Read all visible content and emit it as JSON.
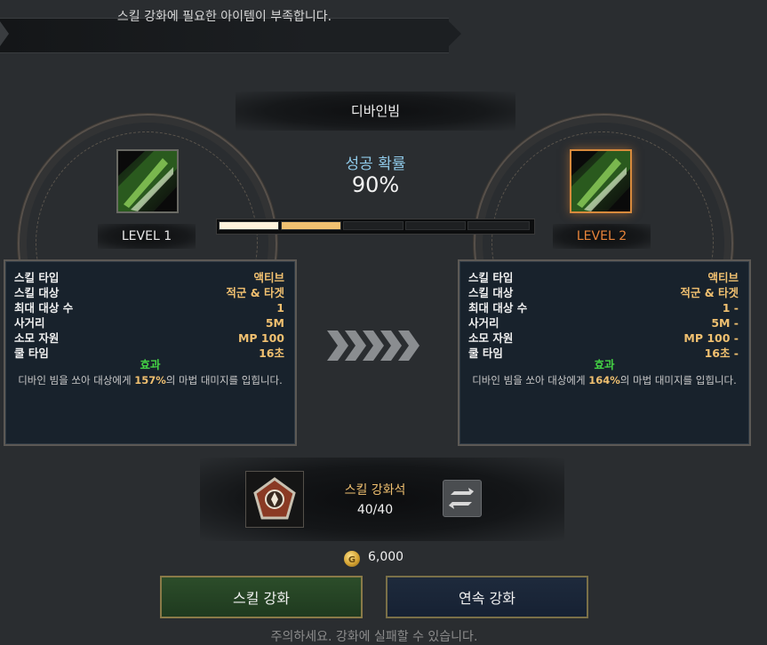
{
  "banner": {
    "message": "스킬 강화에 필요한 아이템이 부족합니다."
  },
  "skill": {
    "name": "디바인빔"
  },
  "success": {
    "label": "성공 확률",
    "value": "90%",
    "progress_filled_segments": 2,
    "progress_total_segments": 5
  },
  "current": {
    "level_label": "LEVEL 1",
    "stats": [
      {
        "label": "스킬 타입",
        "value": "액티브"
      },
      {
        "label": "스킬 대상",
        "value": "적군 & 타겟"
      },
      {
        "label": "최대 대상 수",
        "value": "1"
      },
      {
        "label": "사거리",
        "value": "5M"
      },
      {
        "label": "소모 자원",
        "value": "MP 100"
      },
      {
        "label": "쿨 타임",
        "value": "16초"
      }
    ],
    "effect_title": "효과",
    "effect_pre": "디바인 빔을 쏘아 대상에게 ",
    "effect_highlight": "157%",
    "effect_post": "의 마법 대미지를 입힙니다."
  },
  "next": {
    "level_label": "LEVEL 2",
    "stats": [
      {
        "label": "스킬 타입",
        "value": "액티브"
      },
      {
        "label": "스킬 대상",
        "value": "적군 & 타겟"
      },
      {
        "label": "최대 대상 수",
        "value": "1 -"
      },
      {
        "label": "사거리",
        "value": "5M -"
      },
      {
        "label": "소모 자원",
        "value": "MP 100 -"
      },
      {
        "label": "쿨 타임",
        "value": "16초 -"
      }
    ],
    "effect_title": "효과",
    "effect_pre": "디바인 빔을 쏘아 대상에게 ",
    "effect_highlight": "164%",
    "effect_post": "의 마법 대미지를 입힙니다."
  },
  "material": {
    "name": "스킬 강화석",
    "count": "40/40"
  },
  "cost": {
    "gold": "6,000"
  },
  "buttons": {
    "enhance": "스킬 강화",
    "continuous": "연속 강화"
  },
  "warning": "주의하세요. 강화에 실패할 수 있습니다.",
  "colors": {
    "success_label": "#8fc9e8",
    "stat_value": "#f0c070",
    "effect_title": "#44d244",
    "level2": "#e8843a",
    "progress_fill": "#f0c070"
  }
}
